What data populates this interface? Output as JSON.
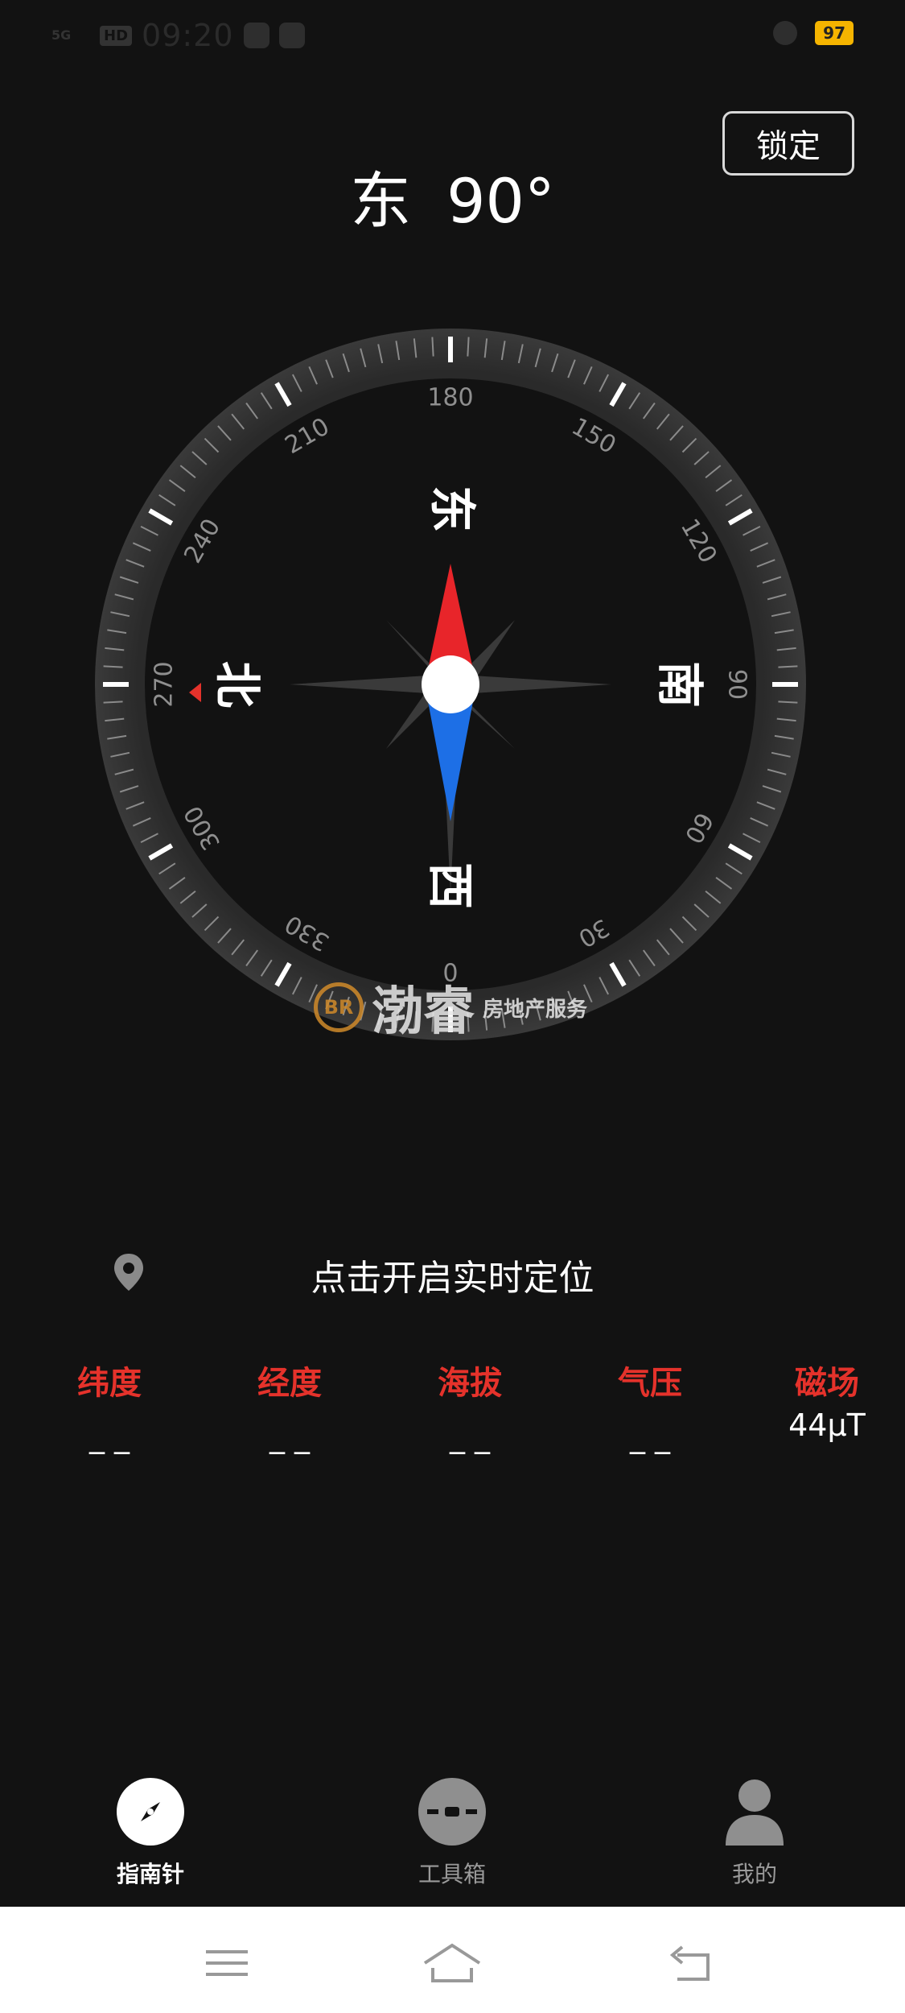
{
  "status_bar": {
    "network": "5G",
    "hd_badge": "HD",
    "time": "09:20",
    "battery": "97",
    "icons": [
      "app-notification-icon",
      "message-icon",
      "alarm-icon"
    ]
  },
  "header": {
    "lock_label": "锁定",
    "direction_label": "东",
    "heading_value": "90°"
  },
  "compass": {
    "cardinals": {
      "north": "北",
      "east": "东",
      "south": "南",
      "west": "西"
    },
    "degree_labels": [
      "0",
      "30",
      "60",
      "90",
      "120",
      "150",
      "180",
      "210",
      "240",
      "270",
      "300",
      "330"
    ],
    "needle_north_color": "#e8252a",
    "needle_south_color": "#1d6fe6",
    "north_marker_color": "#e5322b"
  },
  "watermark": {
    "logo_text": "BR",
    "brand": "渤睿",
    "subtitle": "房地产服务"
  },
  "location": {
    "prompt": "点击开启实时定位",
    "icon": "location-pin-icon"
  },
  "stats": [
    {
      "label": "纬度",
      "value": "_ _"
    },
    {
      "label": "经度",
      "value": "_ _"
    },
    {
      "label": "海拔",
      "value": "_ _"
    },
    {
      "label": "气压",
      "value": "_ _"
    },
    {
      "label": "磁场",
      "value": "44μT"
    }
  ],
  "tabs": [
    {
      "label": "指南针",
      "icon": "compass-icon",
      "active": true
    },
    {
      "label": "工具箱",
      "icon": "toolbox-icon",
      "active": false
    },
    {
      "label": "我的",
      "icon": "profile-icon",
      "active": false
    }
  ],
  "nav": [
    "menu-icon",
    "home-icon",
    "back-icon"
  ],
  "colors": {
    "background": "#121212",
    "accent_red": "#e5322b",
    "inactive": "#9a9a9a"
  }
}
